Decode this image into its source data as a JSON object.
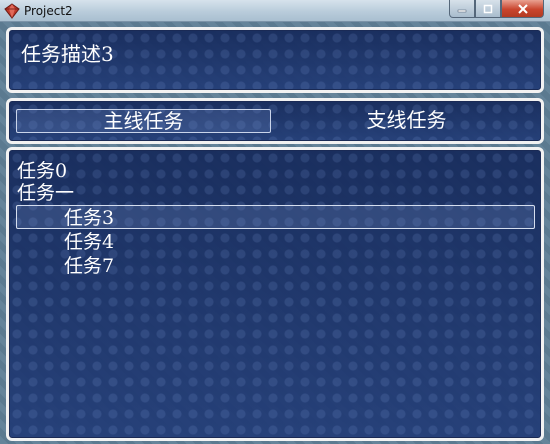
{
  "window": {
    "title": "Project2",
    "icons": {
      "app": "ruby-gem-icon",
      "minimize": "minimize-icon",
      "maximize": "maximize-icon",
      "close": "close-icon"
    }
  },
  "description": {
    "text": "任务描述3"
  },
  "tabs": [
    {
      "label": "主线任务",
      "selected": true
    },
    {
      "label": "支线任务",
      "selected": false
    }
  ],
  "quest_list": {
    "items": [
      {
        "label": "任务0",
        "indent": 0,
        "selected": false
      },
      {
        "label": "任务一",
        "indent": 0,
        "selected": false
      },
      {
        "label": "任务3",
        "indent": 1,
        "selected": true
      },
      {
        "label": "任务4",
        "indent": 1,
        "selected": false
      },
      {
        "label": "任务7",
        "indent": 1,
        "selected": false
      }
    ]
  },
  "colors": {
    "window_bg": "#1e3672",
    "window_border": "#f2f2f2",
    "text": "#ffffff",
    "close_button": "#c9452e"
  }
}
